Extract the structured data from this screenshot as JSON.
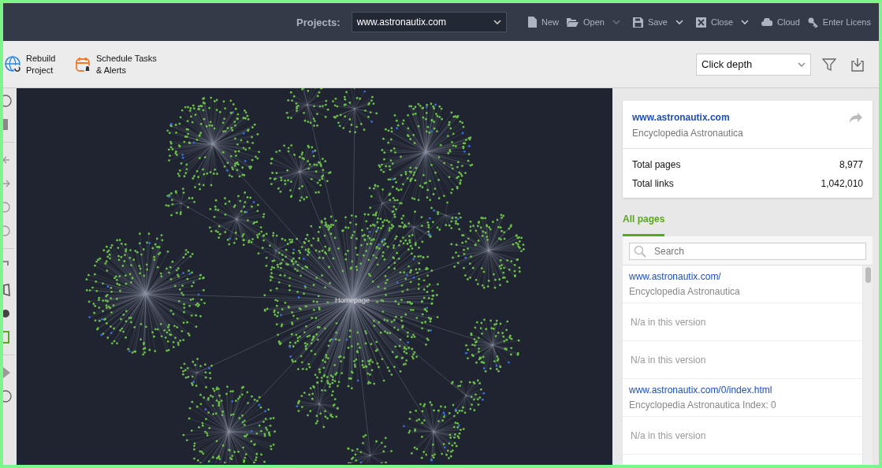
{
  "topbar": {
    "projects_label": "Projects:",
    "project": "www.astronautix.com",
    "buttons": [
      {
        "kind": "new",
        "label": "New",
        "menu": false
      },
      {
        "kind": "open",
        "label": "Open",
        "menu": true
      },
      {
        "kind": "save",
        "label": "Save",
        "menu": true
      },
      {
        "kind": "close",
        "label": "Close",
        "menu": true
      },
      {
        "kind": "cloud",
        "label": "Cloud",
        "menu": false
      },
      {
        "kind": "key",
        "label": "Enter Licens",
        "menu": false
      }
    ]
  },
  "toolbar": {
    "actions": [
      {
        "kind": "rebuild",
        "label": "Rebuild Project"
      },
      {
        "kind": "schedule",
        "label": "Schedule Tasks & Alerts"
      }
    ],
    "view_select": "Click depth"
  },
  "graph": {
    "center_label": "Homepage"
  },
  "site": {
    "url": "www.astronautix.com",
    "title": "Encyclopedia Astronautica",
    "stats": [
      {
        "label": "Total pages",
        "value": "8,977"
      },
      {
        "label": "Total links",
        "value": "1,042,010"
      }
    ]
  },
  "tabs": [
    {
      "label": "All pages",
      "selected": true
    }
  ],
  "search": {
    "placeholder": "Search"
  },
  "pages": [
    {
      "kind": "page",
      "url": "www.astronautix.com/",
      "title": "Encyclopedia Astronautica"
    },
    {
      "kind": "note",
      "text": "N/a in this version"
    },
    {
      "kind": "note",
      "text": "N/a in this version"
    },
    {
      "kind": "page",
      "url": "www.astronautix.com/0/index.html",
      "title": "Encyclopedia Astronautica Index: 0"
    },
    {
      "kind": "note",
      "text": "N/a in this version"
    }
  ]
}
